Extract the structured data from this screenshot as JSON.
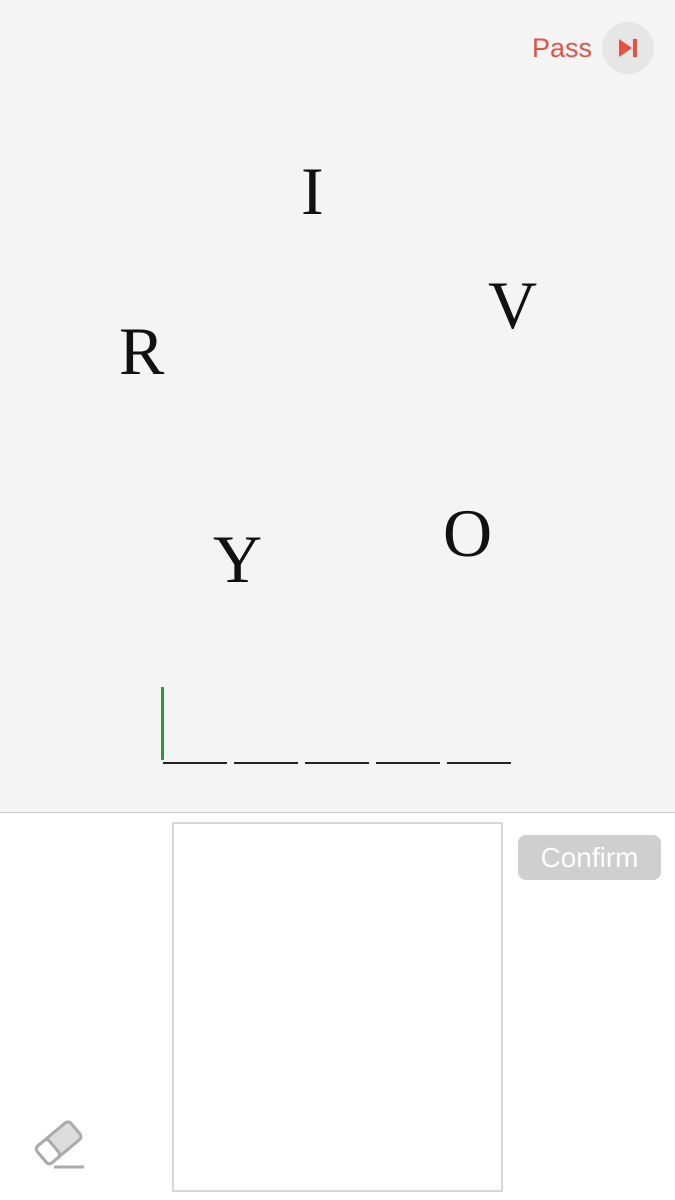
{
  "header": {
    "pass_label": "Pass",
    "pass_icon": "skip-next-icon",
    "accent_color": "#e8513f"
  },
  "puzzle": {
    "letters": [
      "I",
      "V",
      "R",
      "Y",
      "O"
    ],
    "answer_slots": [
      "",
      "",
      "",
      "",
      ""
    ],
    "cursor_color": "#2e9a35"
  },
  "input_panel": {
    "confirm_label": "Confirm",
    "eraser_icon": "eraser-icon"
  }
}
